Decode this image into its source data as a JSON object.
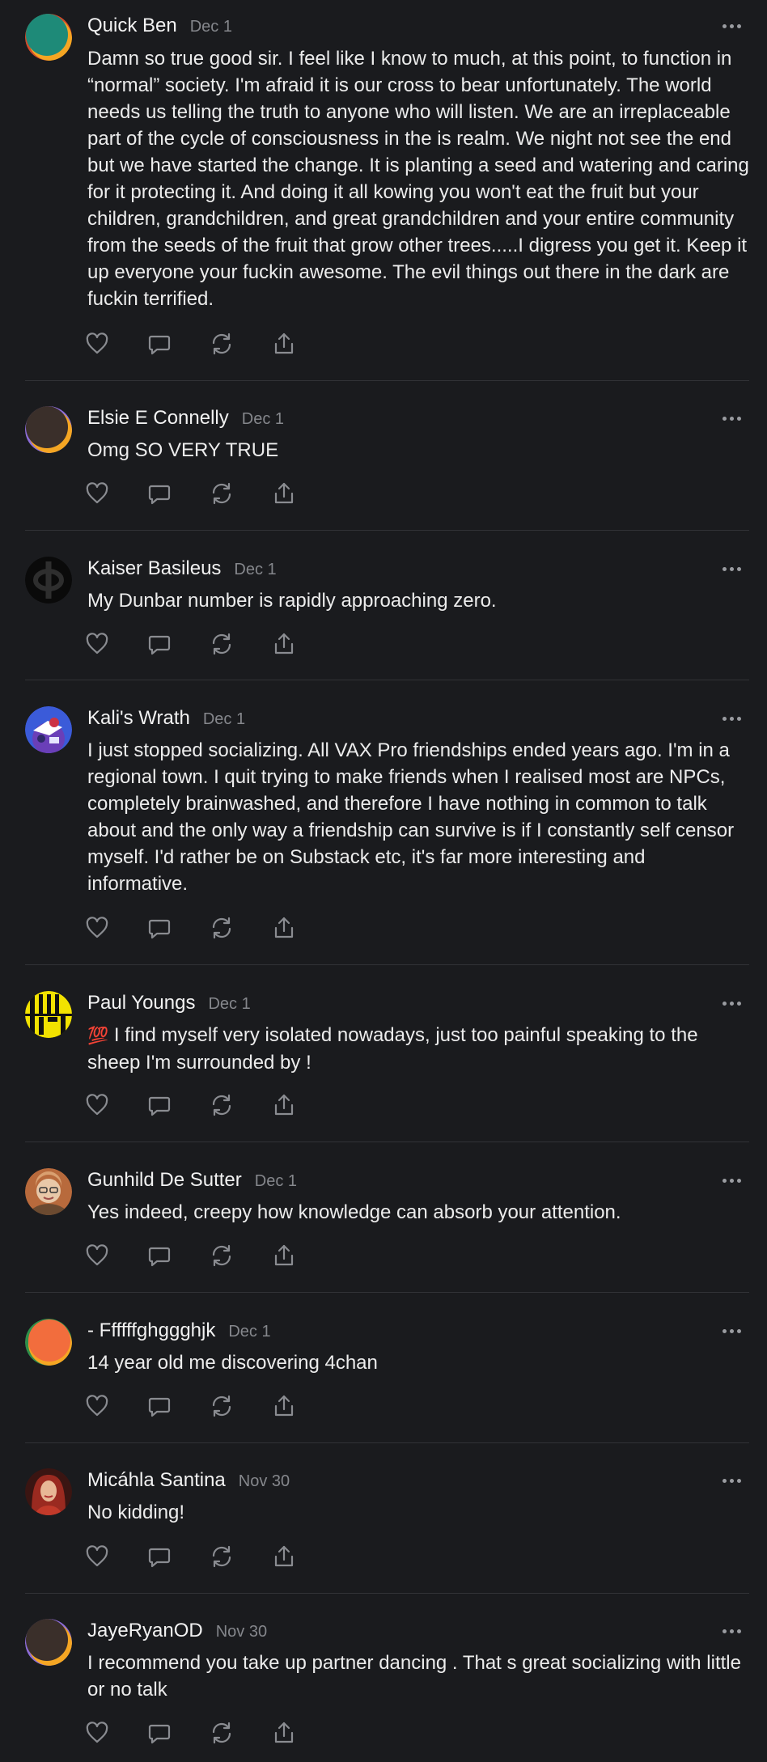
{
  "comments": [
    {
      "name": "Quick Ben",
      "date": "Dec 1",
      "text": "Damn so true good sir. I feel like I know to much, at this point, to function in “normal” society. I'm afraid it is our cross to bear unfortunately. The world needs us telling the truth to anyone who will listen. We are an irreplaceable part of the cycle of consciousness in the is realm. We night not see the end but we have started the change. It is planting a seed and watering and caring for it protecting it. And doing it all kowing you won't eat the fruit but your children, grandchildren, and great grandchildren and your entire community from the seeds of the fruit that grow other trees.....I digress you get it. Keep it up everyone your fuckin awesome. The evil things out there in the dark are fuckin terrified.",
      "avatar_colors": [
        "#1e8a78",
        "#f5a623",
        "#d14a2a"
      ]
    },
    {
      "name": "Elsie E Connelly",
      "date": "Dec 1",
      "text": "Omg SO VERY TRUE",
      "avatar_colors": [
        "#3a2f2a",
        "#f5a623",
        "#8c6cd8"
      ]
    },
    {
      "name": "Kaiser Basileus",
      "date": "Dec 1",
      "text": "My Dunbar number is rapidly approaching zero.",
      "avatar_colors": [
        "#0a0a0a",
        "#2a2a2a"
      ]
    },
    {
      "name": "Kali's Wrath",
      "date": "Dec 1",
      "text": "I just stopped socializing. All VAX Pro friendships ended years ago. I'm in a regional town. I quit trying to make friends when I realised most are NPCs, completely brainwashed, and therefore I have nothing in common to talk about and the only way a friendship can survive is if I constantly self censor myself. I'd rather be on Substack etc, it's far more interesting and informative.",
      "avatar_colors": [
        "#3b5bd9",
        "#ffffff",
        "#cc3344"
      ]
    },
    {
      "name": "Paul Youngs",
      "date": "Dec 1",
      "emoji": "💯",
      "text": " I find myself very isolated nowadays, just too painful speaking to the sheep I'm surrounded by !",
      "avatar_colors": [
        "#f2e200",
        "#111111"
      ]
    },
    {
      "name": "Gunhild De Sutter",
      "date": "Dec 1",
      "text": "Yes indeed, creepy how knowledge can absorb your attention.",
      "avatar_colors": [
        "#b86a3c",
        "#e8c8a8",
        "#6b4a30"
      ]
    },
    {
      "name": "- Ffffffghggghjk",
      "date": "Dec 1",
      "text": "14 year old me discovering 4chan",
      "avatar_colors": [
        "#f26d3d",
        "#2f8f4a",
        "#f5a623"
      ]
    },
    {
      "name": "Micáhla Santina",
      "date": "Nov 30",
      "text": "No kidding!",
      "avatar_colors": [
        "#7a1f1a",
        "#c23a2a",
        "#e8b896"
      ]
    },
    {
      "name": "JayeRyanOD",
      "date": "Nov 30",
      "text": "I recommend you take up partner dancing . That s great socializing with little or no talk",
      "avatar_colors": [
        "#3a2f2a",
        "#f5a623",
        "#8c6cd8"
      ]
    }
  ],
  "actions": {
    "icons": [
      "heart-icon",
      "comment-icon",
      "restack-icon",
      "share-icon"
    ]
  },
  "theme": {
    "background": "#1a1b1e",
    "divider": "#313236",
    "icon": "#8a8c91"
  }
}
